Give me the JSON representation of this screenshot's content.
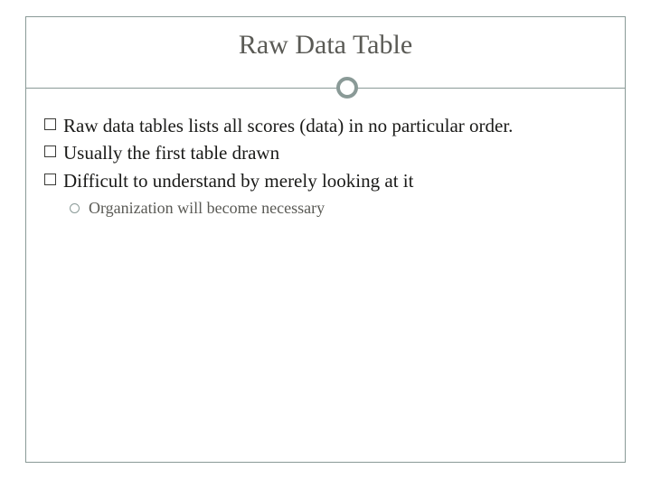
{
  "slide": {
    "title": "Raw Data Table",
    "bullets": [
      {
        "text": "Raw data tables lists all scores (data) in no particular order."
      },
      {
        "text": "Usually the first table drawn"
      },
      {
        "text": "Difficult to understand by merely looking at it"
      }
    ],
    "sub_bullets": [
      {
        "text": "Organization will become necessary"
      }
    ]
  }
}
